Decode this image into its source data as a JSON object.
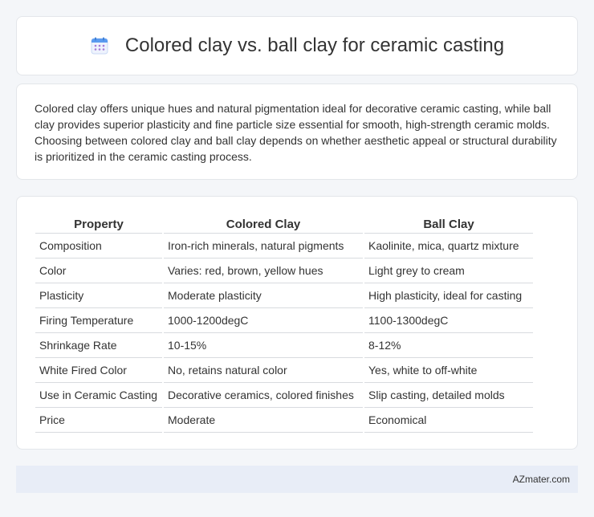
{
  "header": {
    "title": "Colored clay vs. ball clay for ceramic casting",
    "icon": "calendar-icon",
    "icon_colors": {
      "top": "#5b9bf0",
      "body": "#eef3fd",
      "dots": "#a77bd8"
    }
  },
  "intro": {
    "text": "Colored clay offers unique hues and natural pigmentation ideal for decorative ceramic casting, while ball clay provides superior plasticity and fine particle size essential for smooth, high-strength ceramic molds. Choosing between colored clay and ball clay depends on whether aesthetic appeal or structural durability is prioritized in the ceramic casting process."
  },
  "table": {
    "headers": [
      "Property",
      "Colored Clay",
      "Ball Clay"
    ],
    "rows": [
      [
        "Composition",
        "Iron-rich minerals, natural pigments",
        "Kaolinite, mica, quartz mixture"
      ],
      [
        "Color",
        "Varies: red, brown, yellow hues",
        "Light grey to cream"
      ],
      [
        "Plasticity",
        "Moderate plasticity",
        "High plasticity, ideal for casting"
      ],
      [
        "Firing Temperature",
        "1000-1200degC",
        "1100-1300degC"
      ],
      [
        "Shrinkage Rate",
        "10-15%",
        "8-12%"
      ],
      [
        "White Fired Color",
        "No, retains natural color",
        "Yes, white to off-white"
      ],
      [
        "Use in Ceramic Casting",
        "Decorative ceramics, colored finishes",
        "Slip casting, detailed molds"
      ],
      [
        "Price",
        "Moderate",
        "Economical"
      ]
    ]
  },
  "footer": {
    "brand": "AZmater.com"
  }
}
